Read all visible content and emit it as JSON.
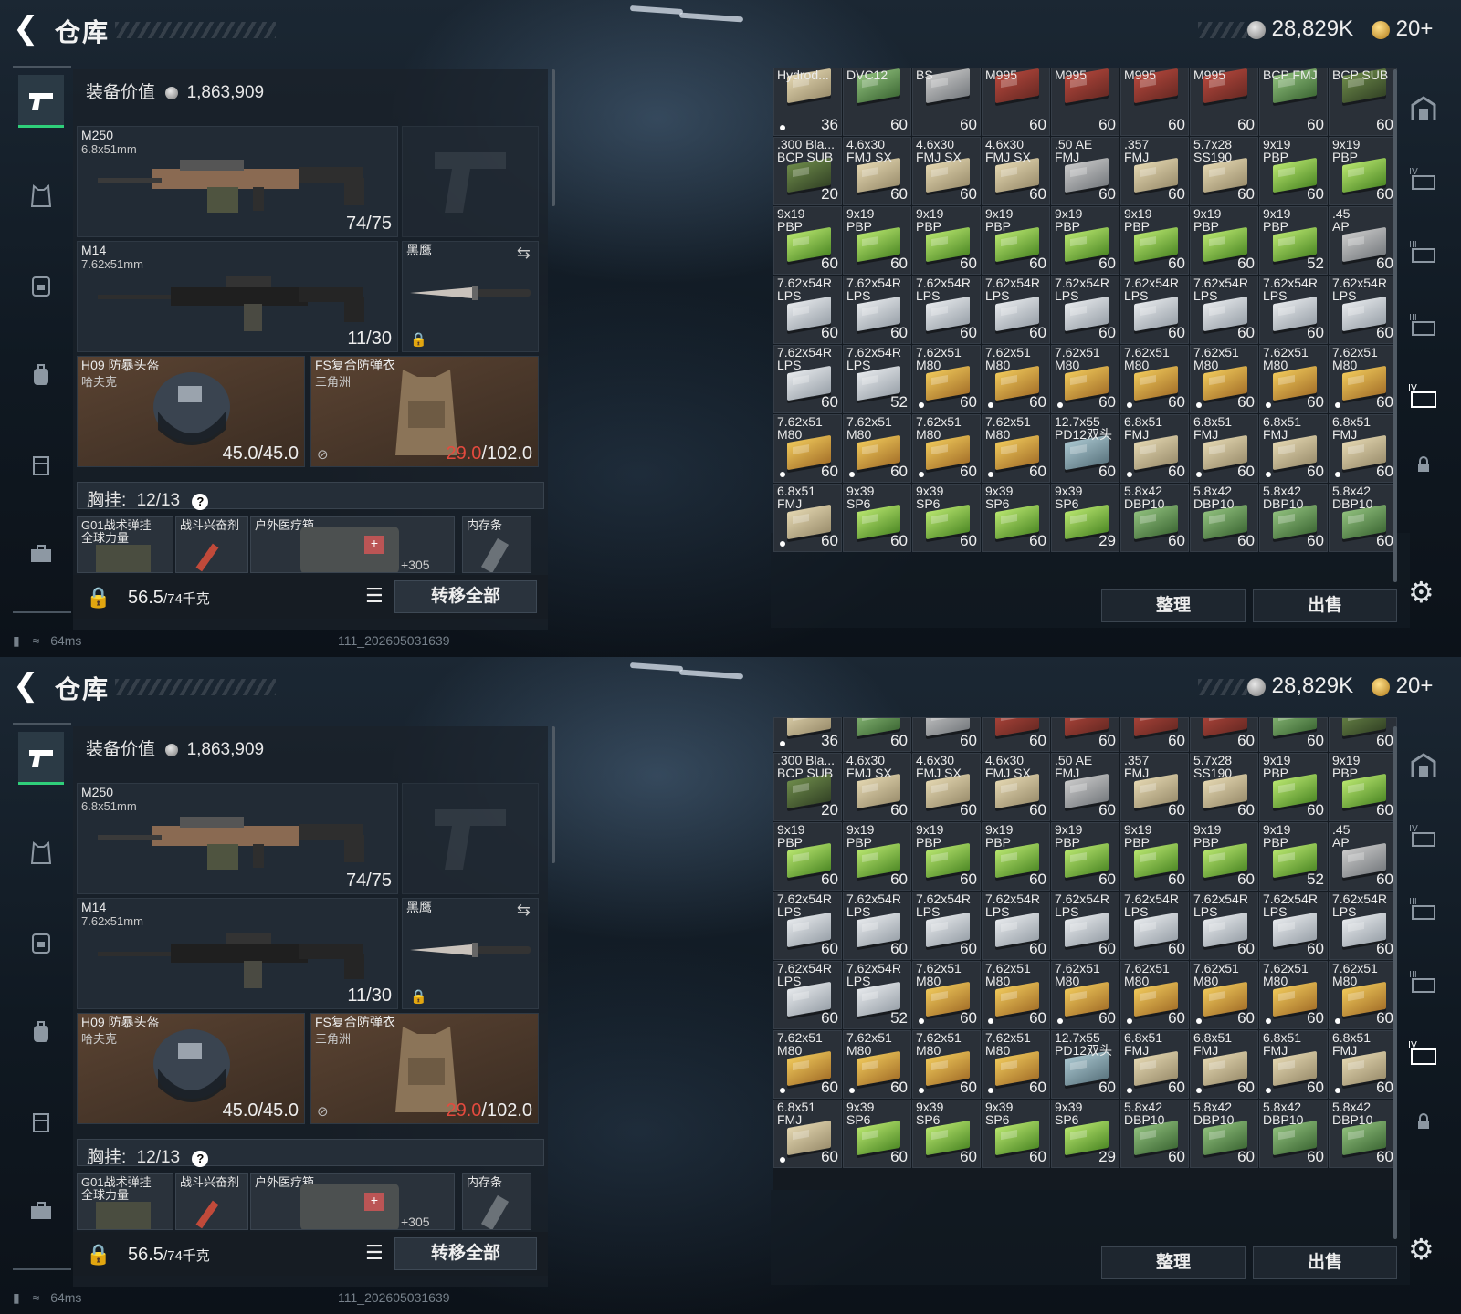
{
  "header": {
    "title": "仓库",
    "silver": "28,829K",
    "gold": "20+"
  },
  "equipment": {
    "value_label": "装备价值",
    "value": "1,863,909",
    "primary": {
      "name": "M250",
      "caliber": "6.8x51mm",
      "ammo": "74/75"
    },
    "secondary": {
      "name": "M14",
      "caliber": "7.62x51mm",
      "ammo": "11/30"
    },
    "melee": {
      "name": "黑鹰"
    },
    "helmet": {
      "name": "H09 防暴头盔",
      "sub": "哈夫克",
      "durability": "45.0/45.0"
    },
    "armor": {
      "name": "FS复合防弹衣",
      "sub": "三角洲",
      "durability_current": "29.0",
      "durability_max": "/102.0"
    },
    "chest_rig": {
      "label": "胸挂:",
      "count": "12/13",
      "help": "?"
    },
    "rig_items": [
      {
        "name": "G01战术弹挂",
        "sub": "全球力量"
      },
      {
        "name": "战斗兴奋剂"
      },
      {
        "name": "户外医疗箱",
        "extra": "+305"
      },
      {
        "name": "内存条"
      }
    ],
    "weight": "56.5",
    "weight_max": "/74千克",
    "transfer_all": "转移全部"
  },
  "status": {
    "ping": "64ms",
    "stamp": "111_202605031639"
  },
  "inventory": {
    "cells": [
      {
        "n1": "Hydrod...",
        "n2": "",
        "c": "36",
        "col": "tan",
        "dot": true
      },
      {
        "n1": "DVC12",
        "n2": "",
        "c": "60",
        "col": "dkgreen",
        "dot": false
      },
      {
        "n1": "BS",
        "n2": "",
        "c": "60",
        "col": "gray",
        "dot": false
      },
      {
        "n1": "M995",
        "n2": "",
        "c": "60",
        "col": "red",
        "dot": false
      },
      {
        "n1": "M995",
        "n2": "",
        "c": "60",
        "col": "red",
        "dot": false
      },
      {
        "n1": "M995",
        "n2": "",
        "c": "60",
        "col": "red",
        "dot": false
      },
      {
        "n1": "M995",
        "n2": "",
        "c": "60",
        "col": "red",
        "dot": false
      },
      {
        "n1": "BCP FMJ",
        "n2": "",
        "c": "60",
        "col": "dkgreen",
        "dot": false
      },
      {
        "n1": "BCP SUB",
        "n2": "",
        "c": "60",
        "col": "olive",
        "dot": false
      },
      {
        "n1": ".300 Bla...",
        "n2": "BCP SUB",
        "c": "20",
        "col": "olive",
        "dot": false
      },
      {
        "n1": "4.6x30",
        "n2": "FMJ SX",
        "c": "60",
        "col": "tan",
        "dot": false
      },
      {
        "n1": "4.6x30",
        "n2": "FMJ SX",
        "c": "60",
        "col": "tan",
        "dot": false
      },
      {
        "n1": "4.6x30",
        "n2": "FMJ SX",
        "c": "60",
        "col": "tan",
        "dot": false
      },
      {
        "n1": ".50 AE",
        "n2": "FMJ",
        "c": "60",
        "col": "gray",
        "dot": false
      },
      {
        "n1": ".357",
        "n2": "FMJ",
        "c": "60",
        "col": "tan",
        "dot": false
      },
      {
        "n1": "5.7x28",
        "n2": "SS190",
        "c": "60",
        "col": "tan",
        "dot": false
      },
      {
        "n1": "9x19",
        "n2": "PBP",
        "c": "60",
        "col": "green",
        "dot": false
      },
      {
        "n1": "9x19",
        "n2": "PBP",
        "c": "60",
        "col": "green",
        "dot": false
      },
      {
        "n1": "9x19",
        "n2": "PBP",
        "c": "60",
        "col": "green",
        "dot": false
      },
      {
        "n1": "9x19",
        "n2": "PBP",
        "c": "60",
        "col": "green",
        "dot": false
      },
      {
        "n1": "9x19",
        "n2": "PBP",
        "c": "60",
        "col": "green",
        "dot": false
      },
      {
        "n1": "9x19",
        "n2": "PBP",
        "c": "60",
        "col": "green",
        "dot": false
      },
      {
        "n1": "9x19",
        "n2": "PBP",
        "c": "60",
        "col": "green",
        "dot": false
      },
      {
        "n1": "9x19",
        "n2": "PBP",
        "c": "60",
        "col": "green",
        "dot": false
      },
      {
        "n1": "9x19",
        "n2": "PBP",
        "c": "60",
        "col": "green",
        "dot": false
      },
      {
        "n1": "9x19",
        "n2": "PBP",
        "c": "52",
        "col": "green",
        "dot": false
      },
      {
        "n1": ".45",
        "n2": "AP",
        "c": "60",
        "col": "gray",
        "dot": false
      },
      {
        "n1": "7.62x54R",
        "n2": "LPS",
        "c": "60",
        "col": "white",
        "dot": false
      },
      {
        "n1": "7.62x54R",
        "n2": "LPS",
        "c": "60",
        "col": "white",
        "dot": false
      },
      {
        "n1": "7.62x54R",
        "n2": "LPS",
        "c": "60",
        "col": "white",
        "dot": false
      },
      {
        "n1": "7.62x54R",
        "n2": "LPS",
        "c": "60",
        "col": "white",
        "dot": false
      },
      {
        "n1": "7.62x54R",
        "n2": "LPS",
        "c": "60",
        "col": "white",
        "dot": false
      },
      {
        "n1": "7.62x54R",
        "n2": "LPS",
        "c": "60",
        "col": "white",
        "dot": false
      },
      {
        "n1": "7.62x54R",
        "n2": "LPS",
        "c": "60",
        "col": "white",
        "dot": false
      },
      {
        "n1": "7.62x54R",
        "n2": "LPS",
        "c": "60",
        "col": "white",
        "dot": false
      },
      {
        "n1": "7.62x54R",
        "n2": "LPS",
        "c": "60",
        "col": "white",
        "dot": false
      },
      {
        "n1": "7.62x54R",
        "n2": "LPS",
        "c": "60",
        "col": "white",
        "dot": false
      },
      {
        "n1": "7.62x54R",
        "n2": "LPS",
        "c": "52",
        "col": "white",
        "dot": false
      },
      {
        "n1": "7.62x51",
        "n2": "M80",
        "c": "60",
        "col": "yellow",
        "dot": true
      },
      {
        "n1": "7.62x51",
        "n2": "M80",
        "c": "60",
        "col": "yellow",
        "dot": true
      },
      {
        "n1": "7.62x51",
        "n2": "M80",
        "c": "60",
        "col": "yellow",
        "dot": true
      },
      {
        "n1": "7.62x51",
        "n2": "M80",
        "c": "60",
        "col": "yellow",
        "dot": true
      },
      {
        "n1": "7.62x51",
        "n2": "M80",
        "c": "60",
        "col": "yellow",
        "dot": true
      },
      {
        "n1": "7.62x51",
        "n2": "M80",
        "c": "60",
        "col": "yellow",
        "dot": true
      },
      {
        "n1": "7.62x51",
        "n2": "M80",
        "c": "60",
        "col": "yellow",
        "dot": true
      },
      {
        "n1": "7.62x51",
        "n2": "M80",
        "c": "60",
        "col": "yellow",
        "dot": true
      },
      {
        "n1": "7.62x51",
        "n2": "M80",
        "c": "60",
        "col": "yellow",
        "dot": true
      },
      {
        "n1": "7.62x51",
        "n2": "M80",
        "c": "60",
        "col": "yellow",
        "dot": true
      },
      {
        "n1": "7.62x51",
        "n2": "M80",
        "c": "60",
        "col": "yellow",
        "dot": true
      },
      {
        "n1": "12.7x55",
        "n2": "PD12双头",
        "c": "60",
        "col": "blue",
        "dot": false
      },
      {
        "n1": "6.8x51",
        "n2": "FMJ",
        "c": "60",
        "col": "tan",
        "dot": true
      },
      {
        "n1": "6.8x51",
        "n2": "FMJ",
        "c": "60",
        "col": "tan",
        "dot": true
      },
      {
        "n1": "6.8x51",
        "n2": "FMJ",
        "c": "60",
        "col": "tan",
        "dot": true
      },
      {
        "n1": "6.8x51",
        "n2": "FMJ",
        "c": "60",
        "col": "tan",
        "dot": true
      },
      {
        "n1": "6.8x51",
        "n2": "FMJ",
        "c": "60",
        "col": "tan",
        "dot": true
      },
      {
        "n1": "9x39",
        "n2": "SP6",
        "c": "60",
        "col": "green",
        "dot": false
      },
      {
        "n1": "9x39",
        "n2": "SP6",
        "c": "60",
        "col": "green",
        "dot": false
      },
      {
        "n1": "9x39",
        "n2": "SP6",
        "c": "60",
        "col": "green",
        "dot": false
      },
      {
        "n1": "9x39",
        "n2": "SP6",
        "c": "29",
        "col": "green",
        "dot": false
      },
      {
        "n1": "5.8x42",
        "n2": "DBP10",
        "c": "60",
        "col": "dkgreen",
        "dot": false
      },
      {
        "n1": "5.8x42",
        "n2": "DBP10",
        "c": "60",
        "col": "dkgreen",
        "dot": false
      },
      {
        "n1": "5.8x42",
        "n2": "DBP10",
        "c": "60",
        "col": "dkgreen",
        "dot": false
      },
      {
        "n1": "5.8x42",
        "n2": "DBP10",
        "c": "60",
        "col": "dkgreen",
        "dot": false
      }
    ],
    "sort_button": "整理",
    "sell_button": "出售"
  },
  "icons": {
    "sidenav": [
      "pistol-icon",
      "vest-icon",
      "armor-icon",
      "backpack-icon",
      "case-icon",
      "briefcase-icon"
    ],
    "rightnav": [
      "safe-icon",
      "storage-1-icon",
      "storage-2-icon",
      "storage-3-icon",
      "storage-4-icon",
      "lock-icon"
    ]
  },
  "colors": {
    "accent_green": "#2fcf7a",
    "armor_low": "#e34a3e",
    "panel": "#1a212a"
  }
}
